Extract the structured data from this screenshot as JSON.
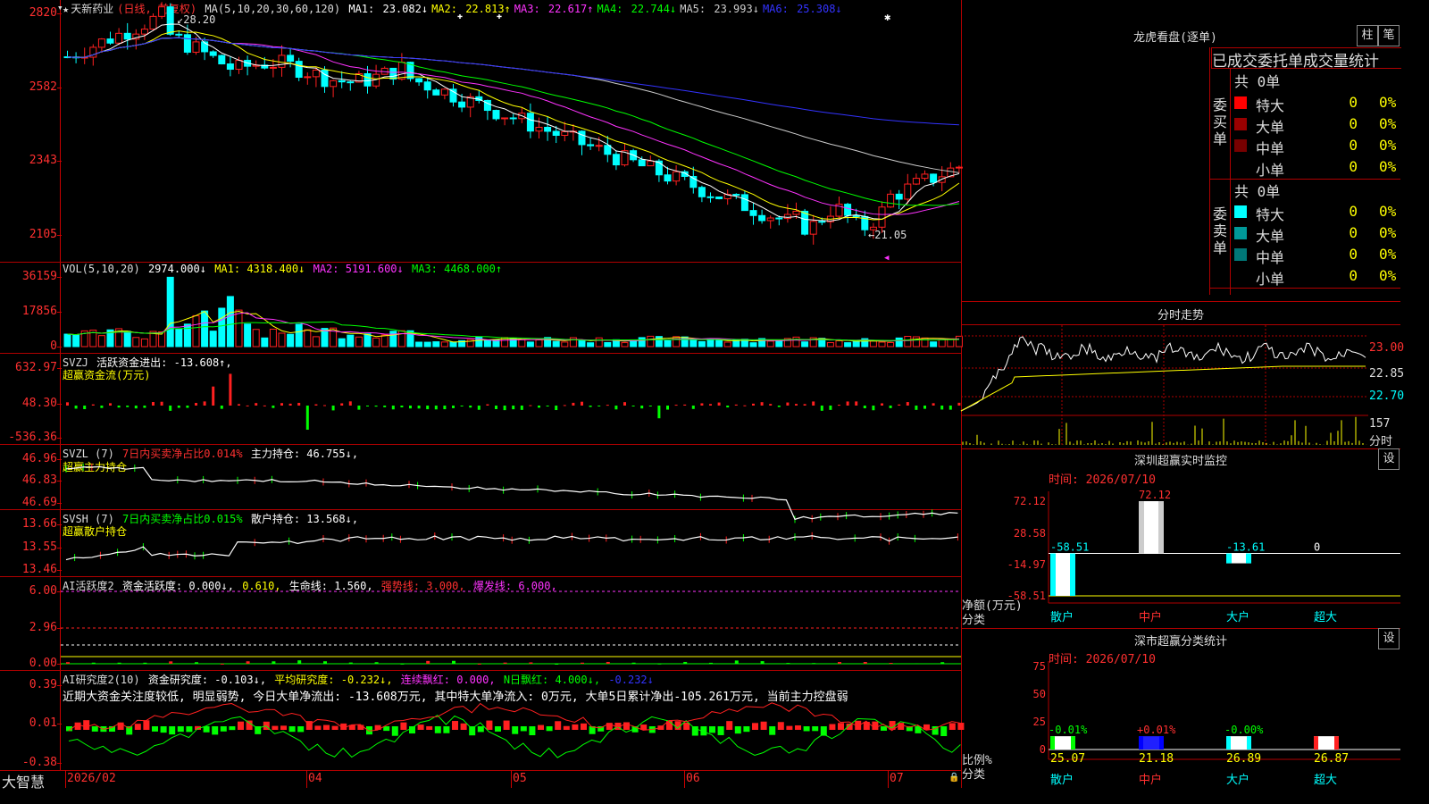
{
  "stock": {
    "name_prefix": "★",
    "name": "天新药业",
    "period": "(日线, 前复权)"
  },
  "main_indicator": {
    "label": "MA(5,10,20,30,60,120)",
    "items": [
      {
        "key": "MA1:",
        "value": "23.082↓",
        "color": "#ffffff"
      },
      {
        "key": "MA2:",
        "value": "22.813↑",
        "color": "#ffff00"
      },
      {
        "key": "MA3:",
        "value": "22.617↑",
        "color": "#ff33ff"
      },
      {
        "key": "MA4:",
        "value": "22.744↓",
        "color": "#00ff00"
      },
      {
        "key": "MA5:",
        "value": "23.993↓",
        "color": "#cccccc"
      },
      {
        "key": "MA6:",
        "value": "25.308↓",
        "color": "#3333ff"
      }
    ],
    "high_label": "28.20",
    "low_label": "←21.05",
    "y_ticks": [
      "2820",
      "2582",
      "2343",
      "2105"
    ]
  },
  "vol": {
    "label": "VOL(5,10,20)",
    "value": "2974.000↓",
    "ma1": "MA1: 4318.400↓",
    "ma2": "MA2: 5191.600↓",
    "ma3": "MA3: 4468.000↑",
    "y_ticks": [
      "36159",
      "17856",
      "0"
    ]
  },
  "svzj": {
    "label": "SVZJ",
    "text": "活跃资金进出: -13.608↑,",
    "subtitle": "超赢资金流(万元)",
    "y_ticks": [
      "632.97",
      "48.30",
      "-536.36"
    ]
  },
  "svzl": {
    "label": "SVZL (7)",
    "text1": "7日内买卖净占比0.014%",
    "text2": "主力持仓: 46.755↓,",
    "subtitle": "超赢主力持仓",
    "y_ticks": [
      "46.96",
      "46.83",
      "46.69"
    ]
  },
  "svsh": {
    "label": "SVSH (7)",
    "text1": "7日内买卖净占比0.015%",
    "text2": "散户持仓: 13.568↓,",
    "subtitle": "超赢散户持仓",
    "y_ticks": [
      "13.66",
      "13.55",
      "13.46"
    ]
  },
  "ai_active": {
    "label": "AI活跃度2",
    "t1": "资金活跃度: 0.000↓,",
    "t2": "0.610,",
    "t3": "生命线: 1.560,",
    "t4": "强势线: 3.000,",
    "t5": "爆发线: 6.000,",
    "y_ticks": [
      "6.00",
      "2.96",
      "0.00"
    ]
  },
  "ai_research": {
    "label": "AI研究度2(10)",
    "t1": "资金研究度: -0.103↓,",
    "t2": "平均研究度: -0.232↓,",
    "t3": "连续飘红: 0.000,",
    "t4": "N日飘红: 4.000↓,",
    "t5": "-0.232↓",
    "comment": "近期大资金关注度较低, 明显弱势, 今日大单净流出: -13.608万元, 其中特大单净流入: 0万元, 大单5日累计净出-105.261万元, 当前主力控盘弱",
    "y_ticks": [
      "0.39",
      "0.01",
      "-0.38"
    ]
  },
  "bottom_bar": {
    "brand": "大智慧",
    "dates": [
      "2026/02",
      "04",
      "05",
      "06",
      "07"
    ]
  },
  "longhu": {
    "title": "龙虎看盘(逐单)",
    "btn1": "柱",
    "btn2": "笔",
    "subtitle": "已成交委托单成交量统计",
    "buy": {
      "side": "委买单",
      "total": "共 0单",
      "rows": [
        {
          "name": "特大",
          "value": "0",
          "pct": "0%",
          "color": "#ff0000"
        },
        {
          "name": "大单",
          "value": "0",
          "pct": "0%",
          "color": "#990000"
        },
        {
          "name": "中单",
          "value": "0",
          "pct": "0%",
          "color": "#770000"
        },
        {
          "name": "小单",
          "value": "0",
          "pct": "0%",
          "color": ""
        }
      ]
    },
    "sell": {
      "side": "委卖单",
      "total": "共 0单",
      "rows": [
        {
          "name": "特大",
          "value": "0",
          "pct": "0%",
          "color": "#00ffff"
        },
        {
          "name": "大单",
          "value": "0",
          "pct": "0%",
          "color": "#009999"
        },
        {
          "name": "中单",
          "value": "0",
          "pct": "0%",
          "color": "#007777"
        },
        {
          "name": "小单",
          "value": "0",
          "pct": "0%",
          "color": ""
        }
      ]
    }
  },
  "intraday": {
    "title": "分时走势",
    "y_ticks": [
      "23.00",
      "22.85",
      "22.70"
    ],
    "vol_label": "157",
    "vol_unit": "分时"
  },
  "monitor": {
    "title": "深圳超赢实时监控",
    "set_btn": "设",
    "time": "时间: 2026/07/10",
    "y_ticks": [
      "72.12",
      "28.58",
      "-14.97",
      "-58.51"
    ],
    "axis_label": "净额(万元)",
    "cat_label": "分类",
    "chart_data": {
      "type": "bar",
      "categories": [
        "散户",
        "中户",
        "大户",
        "超大"
      ],
      "values": [
        -58.51,
        72.12,
        -13.61,
        0
      ],
      "labels": [
        "-58.51",
        "72.12",
        "-13.61",
        "0"
      ],
      "ylim": [
        -58.51,
        72.12
      ]
    }
  },
  "classify": {
    "title": "深市超赢分类统计",
    "set_btn": "设",
    "time": "时间: 2026/07/10",
    "y_ticks": [
      "75",
      "50",
      "25",
      "0"
    ],
    "axis_label": "比例%",
    "cat_label": "分类",
    "chart_data": {
      "type": "bar",
      "categories": [
        "散户",
        "中户",
        "大户",
        "超大"
      ],
      "values": [
        25.07,
        21.18,
        26.89,
        26.87
      ],
      "value_labels": [
        "25.07",
        "21.18",
        "26.89",
        "26.87"
      ],
      "changes": [
        "-0.01%",
        "+0.01%",
        "-0.00%",
        ""
      ],
      "ylim": [
        0,
        75
      ]
    }
  }
}
